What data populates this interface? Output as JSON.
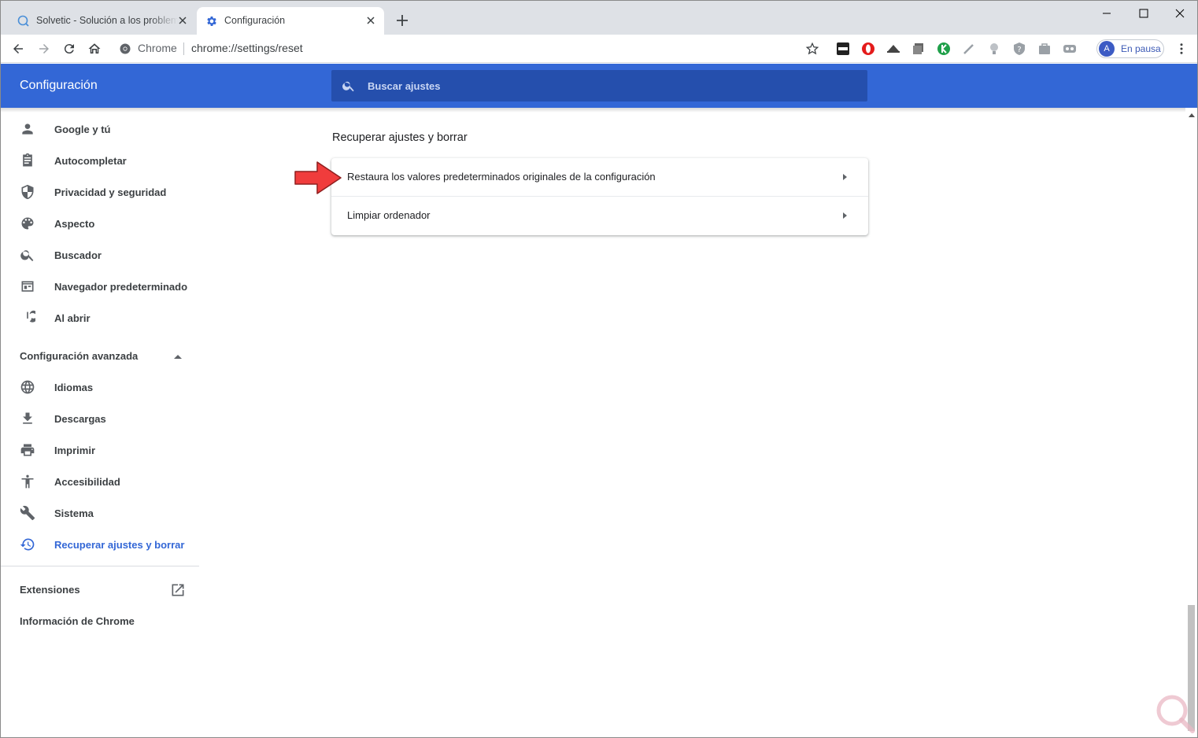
{
  "browser": {
    "tabs": [
      {
        "title": "Solvetic - Solución a los problemas",
        "active": false
      },
      {
        "title": "Configuración",
        "active": true
      }
    ],
    "omnibox": {
      "site_label": "Chrome",
      "url": "chrome://settings/reset"
    },
    "profile": {
      "initial": "A",
      "label": "En pausa"
    },
    "extension_icons": [
      "url-ext-icon",
      "opera-ext-icon",
      "hat-ext-icon",
      "pages-ext-icon",
      "k-ext-icon",
      "pen-ext-icon",
      "bulb-ext-icon",
      "shield-ext-icon",
      "bag-ext-icon",
      "loop-ext-icon"
    ]
  },
  "settings": {
    "header_title": "Configuración",
    "search_placeholder": "Buscar ajustes",
    "sidebar": {
      "items": [
        {
          "label": "Google y tú",
          "icon": "person-icon"
        },
        {
          "label": "Autocompletar",
          "icon": "clipboard-icon"
        },
        {
          "label": "Privacidad y seguridad",
          "icon": "shield-icon"
        },
        {
          "label": "Aspecto",
          "icon": "palette-icon"
        },
        {
          "label": "Buscador",
          "icon": "search-icon"
        },
        {
          "label": "Navegador predeterminado",
          "icon": "browser-window-icon"
        },
        {
          "label": "Al abrir",
          "icon": "power-icon"
        }
      ],
      "advanced_label": "Configuración avanzada",
      "advanced_items": [
        {
          "label": "Idiomas",
          "icon": "globe-icon"
        },
        {
          "label": "Descargas",
          "icon": "download-icon"
        },
        {
          "label": "Imprimir",
          "icon": "printer-icon"
        },
        {
          "label": "Accesibilidad",
          "icon": "accessibility-icon"
        },
        {
          "label": "Sistema",
          "icon": "wrench-icon"
        },
        {
          "label": "Recuperar ajustes y borrar",
          "icon": "history-icon",
          "selected": true
        }
      ],
      "extensions_label": "Extensiones",
      "about_label": "Información de Chrome"
    },
    "main": {
      "section_title": "Recuperar ajustes y borrar",
      "rows": [
        {
          "label": "Restaura los valores predeterminados originales de la configuración"
        },
        {
          "label": "Limpiar ordenador"
        }
      ]
    }
  },
  "colors": {
    "accent": "#3367d6",
    "header": "#3367d6",
    "search_bg": "#254fad",
    "annotation_arrow": "#f03c3c"
  }
}
